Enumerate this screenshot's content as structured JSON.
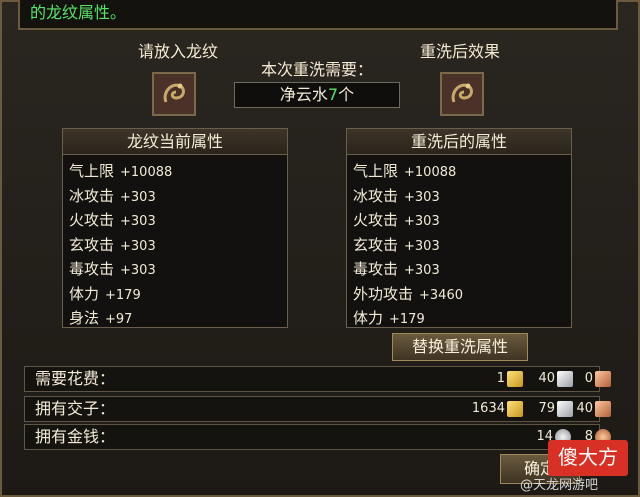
{
  "header": {
    "description": "的龙纹属性。"
  },
  "left_slot": {
    "caption": "请放入龙纹",
    "icon": "dragon-pattern-icon"
  },
  "cost": {
    "caption": "本次重洗需要：",
    "item_name": "净云水",
    "item_qty": "7",
    "item_unit": "个"
  },
  "right_slot": {
    "caption": "重洗后效果",
    "icon": "dragon-pattern-icon"
  },
  "current_panel": {
    "title": "龙纹当前属性",
    "attributes": [
      {
        "name": "气上限",
        "value": "+10088"
      },
      {
        "name": "冰攻击",
        "value": "+303"
      },
      {
        "name": "火攻击",
        "value": "+303"
      },
      {
        "name": "玄攻击",
        "value": "+303"
      },
      {
        "name": "毒攻击",
        "value": "+303"
      },
      {
        "name": "体力",
        "value": "+179"
      },
      {
        "name": "身法",
        "value": "+97"
      }
    ]
  },
  "after_panel": {
    "title": "重洗后的属性",
    "attributes": [
      {
        "name": "气上限",
        "value": "+10088"
      },
      {
        "name": "冰攻击",
        "value": "+303"
      },
      {
        "name": "火攻击",
        "value": "+303"
      },
      {
        "name": "玄攻击",
        "value": "+303"
      },
      {
        "name": "毒攻击",
        "value": "+303"
      },
      {
        "name": "外功攻击",
        "value": "+3460"
      },
      {
        "name": "体力",
        "value": "+179"
      }
    ]
  },
  "replace_button": {
    "label": "替换重洗属性"
  },
  "rows": {
    "cost": {
      "label": "需要花费：",
      "gold": "1",
      "silver": "40",
      "copper": "0"
    },
    "jiaozi": {
      "label": "拥有交子：",
      "gold": "1634",
      "silver": "79",
      "copper": "40"
    },
    "money": {
      "label": "拥有金钱：",
      "silver": "14",
      "copper": "8"
    }
  },
  "confirm_button": {
    "label": "确定"
  },
  "watermark": {
    "logo_text": "傻大方",
    "caption": "@天龙网游吧"
  },
  "colors": {
    "accent_green": "#58e36a",
    "gold": "#e8b43a",
    "frame": "#6b5a3e"
  }
}
